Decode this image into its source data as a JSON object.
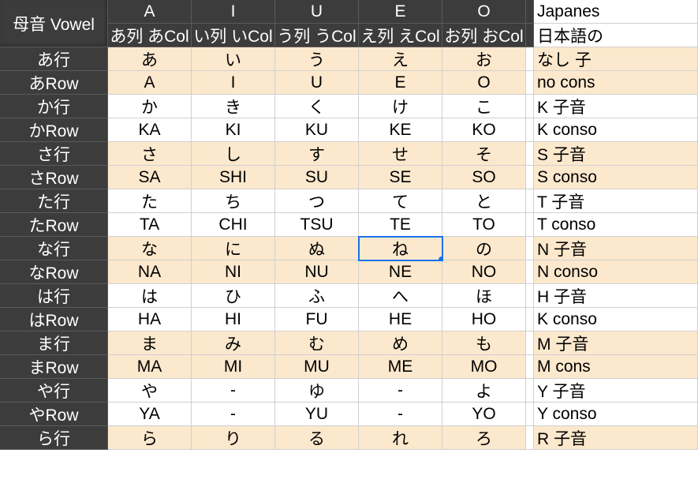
{
  "header": {
    "corner": "母音 Vowel",
    "vowels": [
      "A",
      "I",
      "U",
      "E",
      "O"
    ],
    "subcols": [
      "あ列 あCol",
      "い列 いCol",
      "う列 うCol",
      "え列 えCol",
      "お列 おCol"
    ],
    "right1": "Japanes",
    "right2": "日本語の"
  },
  "rows": [
    {
      "hdr": "あ行",
      "cells": [
        "あ",
        "い",
        "う",
        "え",
        "お"
      ],
      "note": "なし 子",
      "tan": true
    },
    {
      "hdr": "あRow",
      "cells": [
        "A",
        "I",
        "U",
        "E",
        "O"
      ],
      "note": "no cons",
      "tan": true
    },
    {
      "hdr": "か行",
      "cells": [
        "か",
        "き",
        "く",
        "け",
        "こ"
      ],
      "note": "K 子音",
      "tan": false
    },
    {
      "hdr": "かRow",
      "cells": [
        "KA",
        "KI",
        "KU",
        "KE",
        "KO"
      ],
      "note": "K conso",
      "tan": false
    },
    {
      "hdr": "さ行",
      "cells": [
        "さ",
        "し",
        "す",
        "せ",
        "そ"
      ],
      "note": "S 子音",
      "tan": true
    },
    {
      "hdr": "さRow",
      "cells": [
        "SA",
        "SHI",
        "SU",
        "SE",
        "SO"
      ],
      "note": "S conso",
      "tan": true
    },
    {
      "hdr": "た行",
      "cells": [
        "た",
        "ち",
        "つ",
        "て",
        "と"
      ],
      "note": "T 子音",
      "tan": false
    },
    {
      "hdr": "たRow",
      "cells": [
        "TA",
        "CHI",
        "TSU",
        "TE",
        "TO"
      ],
      "note": "T conso",
      "tan": false
    },
    {
      "hdr": "な行",
      "cells": [
        "な",
        "に",
        "ぬ",
        "ね",
        "の"
      ],
      "note": "N 子音",
      "tan": true
    },
    {
      "hdr": "なRow",
      "cells": [
        "NA",
        "NI",
        "NU",
        "NE",
        "NO"
      ],
      "note": "N conso",
      "tan": true
    },
    {
      "hdr": "は行",
      "cells": [
        "は",
        "ひ",
        "ふ",
        "へ",
        "ほ"
      ],
      "note": "H 子音",
      "tan": false
    },
    {
      "hdr": "はRow",
      "cells": [
        "HA",
        "HI",
        "FU",
        "HE",
        "HO"
      ],
      "note": "K conso",
      "tan": false
    },
    {
      "hdr": "ま行",
      "cells": [
        "ま",
        "み",
        "む",
        "め",
        "も"
      ],
      "note": "M 子音",
      "tan": true
    },
    {
      "hdr": "まRow",
      "cells": [
        "MA",
        "MI",
        "MU",
        "ME",
        "MO"
      ],
      "note": "M cons",
      "tan": true
    },
    {
      "hdr": "や行",
      "cells": [
        "や",
        "-",
        "ゆ",
        "-",
        "よ"
      ],
      "note": "Y 子音",
      "tan": false
    },
    {
      "hdr": "やRow",
      "cells": [
        "YA",
        "-",
        "YU",
        "-",
        "YO"
      ],
      "note": "Y conso",
      "tan": false
    },
    {
      "hdr": "ら行",
      "cells": [
        "ら",
        "り",
        "る",
        "れ",
        "ろ"
      ],
      "note": "R 子音",
      "tan": true
    }
  ],
  "selection": {
    "row": 8,
    "col": 3
  },
  "chart_data": {
    "type": "table",
    "title": "母音 Vowel",
    "columns": [
      "A",
      "I",
      "U",
      "E",
      "O"
    ],
    "column_subtitles": [
      "あ列 あCol",
      "い列 いCol",
      "う列 うCol",
      "え列 えCol",
      "お列 おCol"
    ],
    "row_labels": [
      "あ行",
      "あRow",
      "か行",
      "かRow",
      "さ行",
      "さRow",
      "た行",
      "たRow",
      "な行",
      "なRow",
      "は行",
      "はRow",
      "ま行",
      "まRow",
      "や行",
      "やRow",
      "ら行"
    ],
    "data": [
      [
        "あ",
        "い",
        "う",
        "え",
        "お"
      ],
      [
        "A",
        "I",
        "U",
        "E",
        "O"
      ],
      [
        "か",
        "き",
        "く",
        "け",
        "こ"
      ],
      [
        "KA",
        "KI",
        "KU",
        "KE",
        "KO"
      ],
      [
        "さ",
        "し",
        "す",
        "せ",
        "そ"
      ],
      [
        "SA",
        "SHI",
        "SU",
        "SE",
        "SO"
      ],
      [
        "た",
        "ち",
        "つ",
        "て",
        "と"
      ],
      [
        "TA",
        "CHI",
        "TSU",
        "TE",
        "TO"
      ],
      [
        "な",
        "に",
        "ぬ",
        "ね",
        "の"
      ],
      [
        "NA",
        "NI",
        "NU",
        "NE",
        "NO"
      ],
      [
        "は",
        "ひ",
        "ふ",
        "へ",
        "ほ"
      ],
      [
        "HA",
        "HI",
        "FU",
        "HE",
        "HO"
      ],
      [
        "ま",
        "み",
        "む",
        "め",
        "も"
      ],
      [
        "MA",
        "MI",
        "MU",
        "ME",
        "MO"
      ],
      [
        "や",
        "-",
        "ゆ",
        "-",
        "よ"
      ],
      [
        "YA",
        "-",
        "YU",
        "-",
        "YO"
      ],
      [
        "ら",
        "り",
        "る",
        "れ",
        "ろ"
      ]
    ],
    "notes": [
      "なし 子",
      "no cons",
      "K 子音",
      "K conso",
      "S 子音",
      "S conso",
      "T 子音",
      "T conso",
      "N 子音",
      "N conso",
      "H 子音",
      "K conso",
      "M 子音",
      "M cons",
      "Y 子音",
      "Y conso",
      "R 子音"
    ]
  }
}
